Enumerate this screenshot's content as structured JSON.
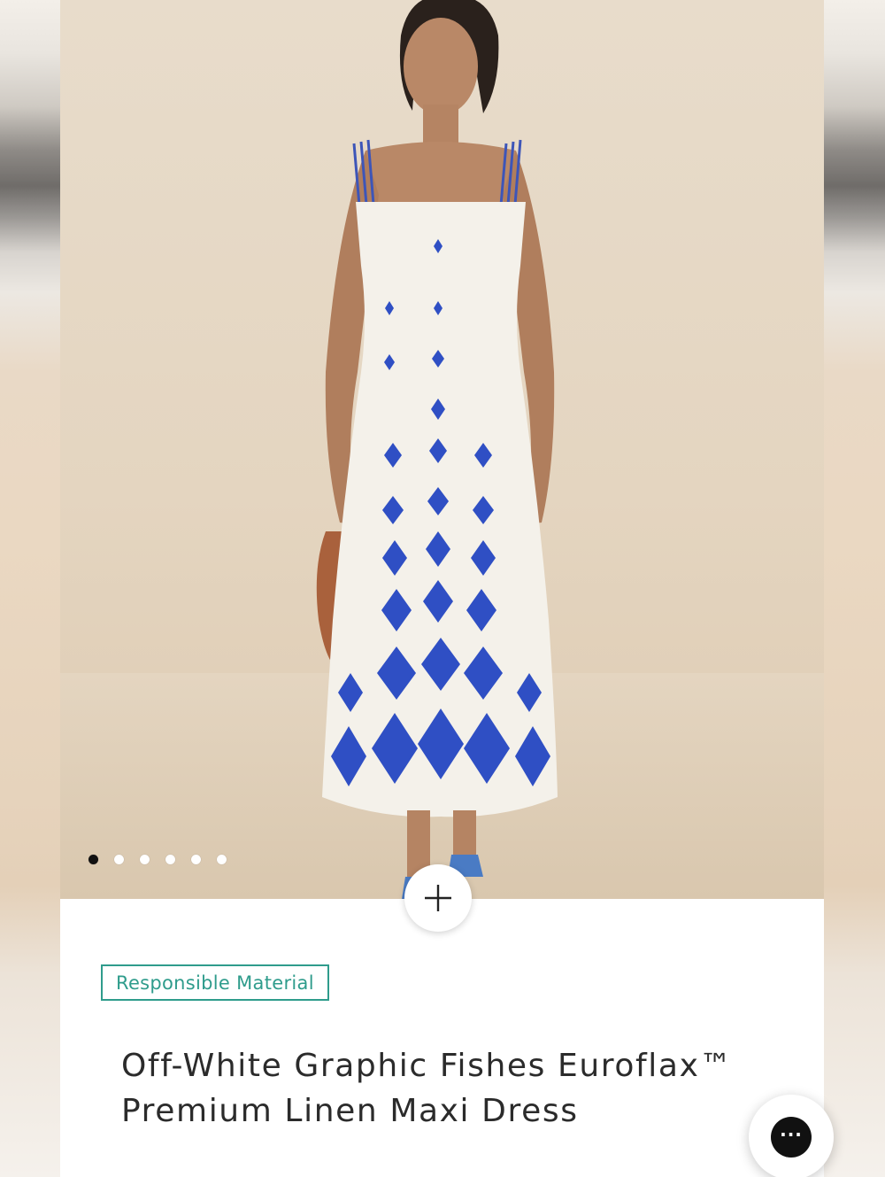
{
  "gallery": {
    "image_alt": "Model wearing off-white linen maxi dress with blue graphic fish print",
    "slide_count": 6,
    "active_slide": 1
  },
  "zoom_button": {
    "icon": "plus-icon"
  },
  "badge": {
    "label": "Responsible Material"
  },
  "product": {
    "title": "Off-White Graphic Fishes Euroflax™ Premium Linen Maxi Dress"
  },
  "chat": {
    "icon": "chat-ellipsis-icon",
    "glyph": "···"
  },
  "colors": {
    "badge_accent": "#2f9c8c",
    "print_blue": "#2f4fc4",
    "dress": "#f4f1ea"
  }
}
